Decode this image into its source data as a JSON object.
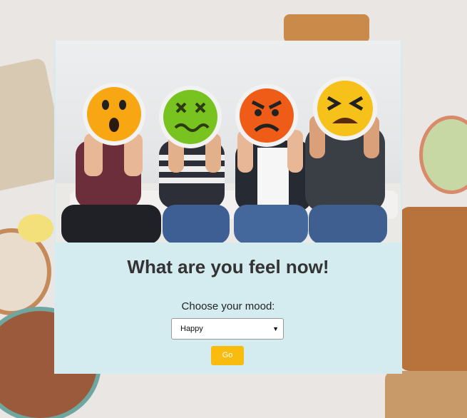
{
  "heading": "What are you feel now!",
  "mood_label": "Choose your mood:",
  "mood_select": {
    "selected": "Happy"
  },
  "go_button": "Go",
  "photo": {
    "faces": [
      "surprised-emoji",
      "sick-emoji",
      "angry-emoji",
      "frustrated-emoji"
    ],
    "colors": {
      "surprised": "#f8a612",
      "sick": "#78c31f",
      "angry": "#ef5c17",
      "frustrated": "#f6c21a"
    }
  },
  "colors": {
    "card": "#d4ebf0",
    "button": "#f8bb0e",
    "background": "#e9e6e3"
  }
}
